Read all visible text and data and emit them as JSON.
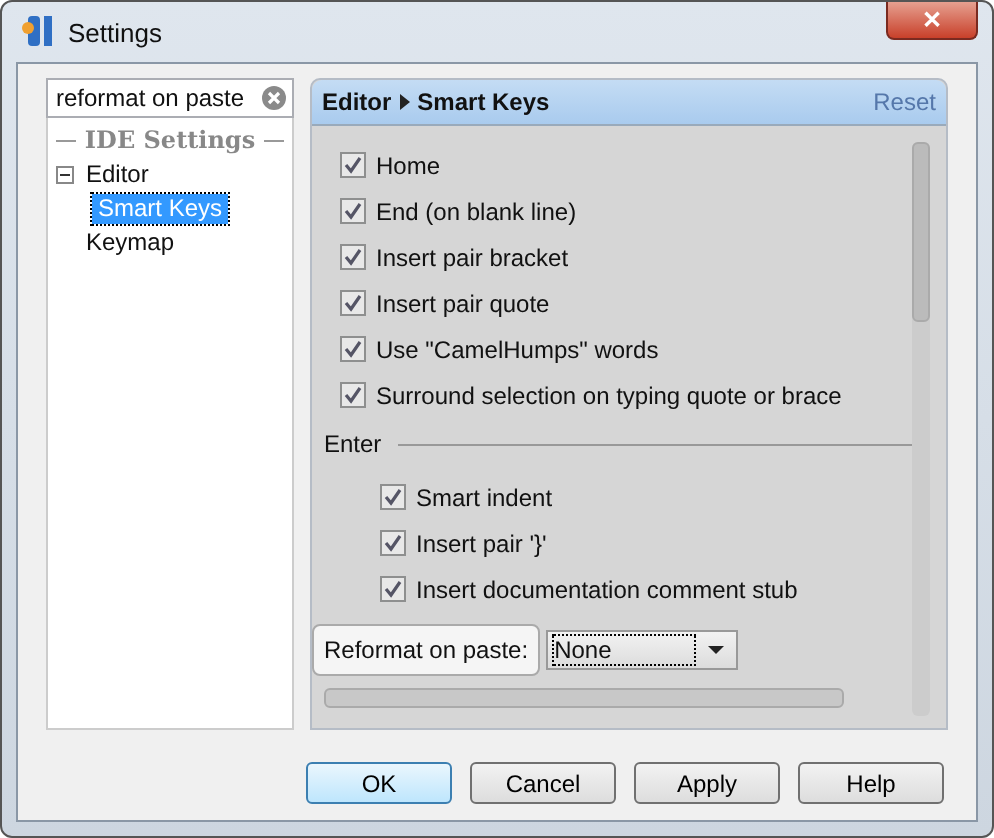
{
  "window": {
    "title": "Settings",
    "close": "✕"
  },
  "search": {
    "value": "reformat on paste"
  },
  "tree": {
    "section": "IDE Settings",
    "items": [
      {
        "label": "Editor",
        "expanded": true,
        "selected": false,
        "children": [
          {
            "label": "Smart Keys",
            "selected": true
          }
        ]
      },
      {
        "label": "Keymap",
        "selected": false
      }
    ]
  },
  "header": {
    "path": [
      "Editor",
      "Smart Keys"
    ],
    "reset": "Reset"
  },
  "options": [
    {
      "label": "Home",
      "checked": true
    },
    {
      "label": "End (on blank line)",
      "checked": true
    },
    {
      "label": "Insert pair bracket",
      "checked": true
    },
    {
      "label": "Insert pair quote",
      "checked": true
    },
    {
      "label": "Use \"CamelHumps\" words",
      "checked": true
    },
    {
      "label": "Surround selection on typing quote or brace",
      "checked": true
    }
  ],
  "enter": {
    "title": "Enter",
    "options": [
      {
        "label": "Smart indent",
        "checked": true
      },
      {
        "label": "Insert pair '}'",
        "checked": true
      },
      {
        "label": "Insert documentation comment stub",
        "checked": true
      }
    ]
  },
  "reformat": {
    "label": "Reformat on paste:",
    "value": "None"
  },
  "buttons": [
    {
      "label": "OK",
      "default": true
    },
    {
      "label": "Cancel",
      "default": false
    },
    {
      "label": "Apply",
      "default": false
    },
    {
      "label": "Help",
      "default": false
    }
  ]
}
